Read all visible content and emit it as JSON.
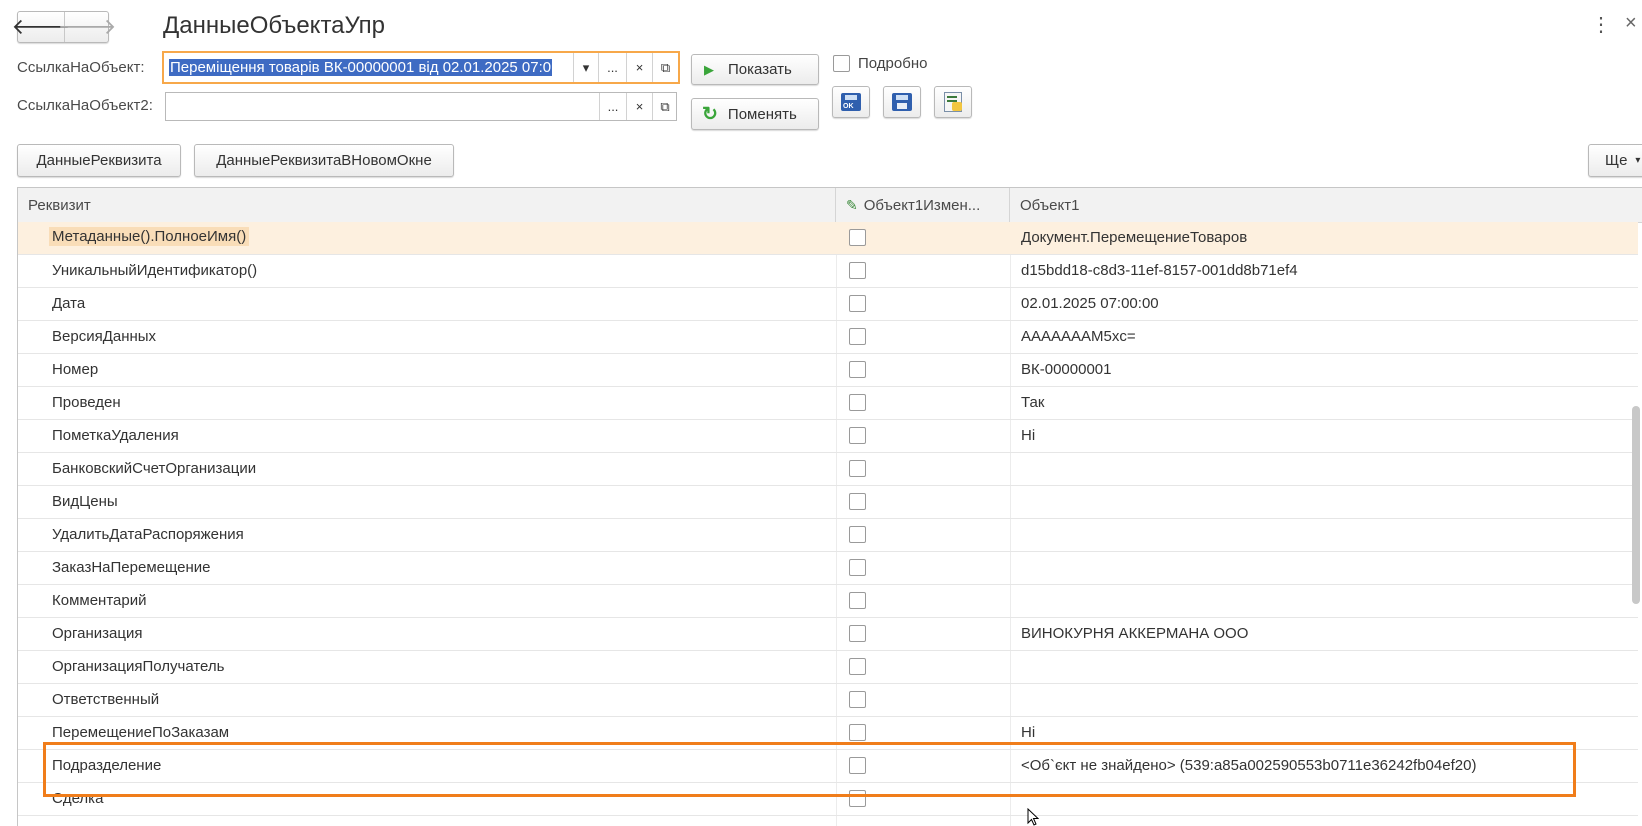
{
  "window": {
    "title": "ДанныеОбъектаУпр",
    "more_menu": "⋮",
    "close": "×"
  },
  "nav": {
    "back": "🡐",
    "forward": "🡒"
  },
  "form": {
    "ref1_label": "СсылкаНаОбъект:",
    "ref1_value": "Переміщення товарів ВК-00000001 від 02.01.2025 07:0",
    "ref2_label": "СсылкаНаОбъект2:",
    "ref2_value": "",
    "select_btn": "...",
    "clear_btn": "×",
    "open_btn": "⧉",
    "dropdown_btn": "▾",
    "show_btn": "Показать",
    "swap_btn": "Поменять",
    "detail_label": "Подробно",
    "detail_checked": false
  },
  "toolbar": {
    "attr_data_btn": "ДанныеРеквизита",
    "attr_data_new_window_btn": "ДанныеРеквизитаВНовомОкне",
    "more_btn": "Ще"
  },
  "table": {
    "headers": {
      "attribute": "Реквизит",
      "changed": "Объект1Измен...",
      "object1": "Объект1"
    },
    "rows": [
      {
        "name": "Метаданные().ПолноеИмя()",
        "value": "Документ.ПеремещениеТоваров"
      },
      {
        "name": "УникальныйИдентификатор()",
        "value": "d15bdd18-c8d3-11ef-8157-001dd8b71ef4"
      },
      {
        "name": "Дата",
        "value": "02.01.2025 07:00:00"
      },
      {
        "name": "ВерсияДанных",
        "value": "AAAAAAAM5xc="
      },
      {
        "name": "Номер",
        "value": "ВК-00000001"
      },
      {
        "name": "Проведен",
        "value": "Так"
      },
      {
        "name": "ПометкаУдаления",
        "value": "Ні"
      },
      {
        "name": "БанковскийСчетОрганизации",
        "value": ""
      },
      {
        "name": "ВидЦены",
        "value": ""
      },
      {
        "name": "УдалитьДатаРаспоряжения",
        "value": ""
      },
      {
        "name": "ЗаказНаПеремещение",
        "value": ""
      },
      {
        "name": "Комментарий",
        "value": ""
      },
      {
        "name": "Организация",
        "value": "ВИНОКУРНЯ АККЕРМАНА ООО"
      },
      {
        "name": "ОрганизацияПолучатель",
        "value": ""
      },
      {
        "name": "Ответственный",
        "value": ""
      },
      {
        "name": "ПеремещениеПоЗаказам",
        "value": "Ні"
      },
      {
        "name": "Подразделение",
        "value": "<Об`єкт не знайдено> (539:a85a002590553b0711e36242fb04ef20)"
      },
      {
        "name": "Сделка",
        "value": ""
      }
    ]
  },
  "colors": {
    "highlight_border": "#f07d1a",
    "selected_row": "#fdf0df",
    "focus_border": "#f7a84a"
  }
}
